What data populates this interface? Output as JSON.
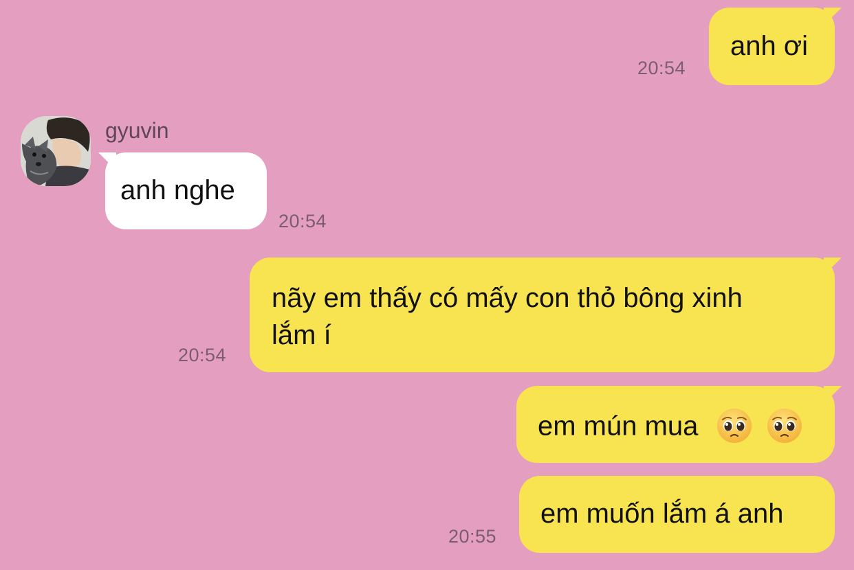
{
  "chat": {
    "sender_name": "gyuvin",
    "avatar": "avatar-photo",
    "messages": [
      {
        "side": "outgoing",
        "text": "anh ơi",
        "time": "20:54"
      },
      {
        "side": "incoming",
        "text": "anh nghe",
        "time": "20:54"
      },
      {
        "side": "outgoing",
        "text_line1": "nãy em thấy có mấy con thỏ bông xinh",
        "text_line2": "lắm í",
        "time": "20:54"
      },
      {
        "side": "outgoing",
        "text": "em mún mua",
        "emojis": [
          "pleading-face-emoji",
          "pleading-face-emoji"
        ]
      },
      {
        "side": "outgoing",
        "text": "em muốn lắm á anh",
        "time": "20:55"
      }
    ]
  },
  "colors": {
    "background": "#e49ebf",
    "outgoing_bubble": "#f8e350",
    "incoming_bubble": "#ffffff",
    "timestamp": "#7b5d6f"
  }
}
